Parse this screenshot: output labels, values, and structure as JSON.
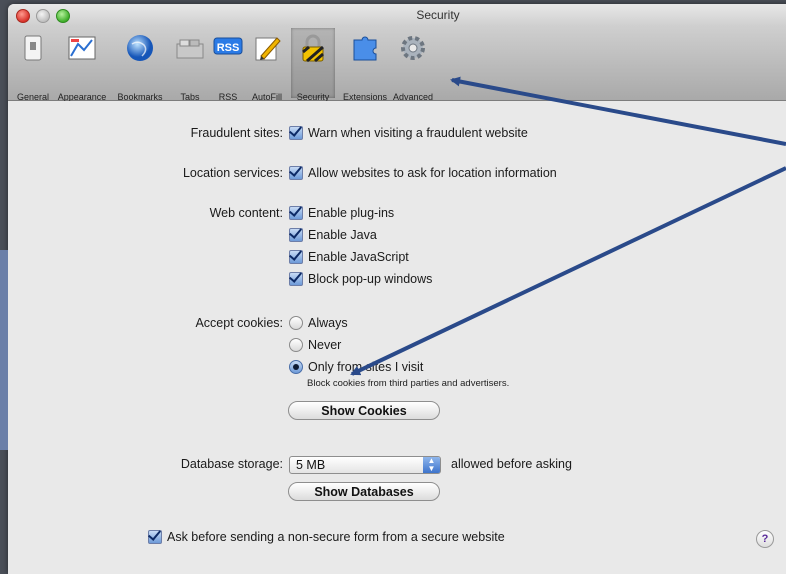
{
  "window": {
    "title": "Security"
  },
  "toolbar": {
    "items": [
      {
        "label": "General",
        "icon": "general-switch-icon"
      },
      {
        "label": "Appearance",
        "icon": "appearance-icon"
      },
      {
        "label": "Bookmarks",
        "icon": "globe-icon"
      },
      {
        "label": "Tabs",
        "icon": "tabs-icon"
      },
      {
        "label": "RSS",
        "icon": "rss-icon"
      },
      {
        "label": "AutoFill",
        "icon": "pencil-form-icon"
      },
      {
        "label": "Security",
        "icon": "padlock-icon"
      },
      {
        "label": "Extensions",
        "icon": "puzzle-icon"
      },
      {
        "label": "Advanced",
        "icon": "gear-icon"
      }
    ],
    "selected": "Security",
    "rss_badge": "RSS"
  },
  "security": {
    "fraudulent": {
      "label": "Fraudulent sites:",
      "option": "Warn when visiting a fraudulent website",
      "checked": true
    },
    "location": {
      "label": "Location services:",
      "option": "Allow websites to ask for location information",
      "checked": true
    },
    "web_content": {
      "label": "Web content:",
      "options": [
        {
          "text": "Enable plug-ins",
          "checked": true
        },
        {
          "text": "Enable Java",
          "checked": true
        },
        {
          "text": "Enable JavaScript",
          "checked": true
        },
        {
          "text": "Block pop-up windows",
          "checked": true
        }
      ]
    },
    "cookies": {
      "label": "Accept cookies:",
      "options": [
        "Always",
        "Never",
        "Only from sites I visit"
      ],
      "selected": "Only from sites I visit",
      "hint": "Block cookies from third parties and advertisers.",
      "button": "Show Cookies"
    },
    "database": {
      "label": "Database storage:",
      "value": "5 MB",
      "suffix": "allowed before asking",
      "button": "Show Databases"
    },
    "nonsecure": {
      "option": "Ask before sending a non-secure form from a secure website",
      "checked": true
    },
    "help": "?"
  },
  "colors": {
    "annotation_arrow": "#2a4a8a"
  }
}
